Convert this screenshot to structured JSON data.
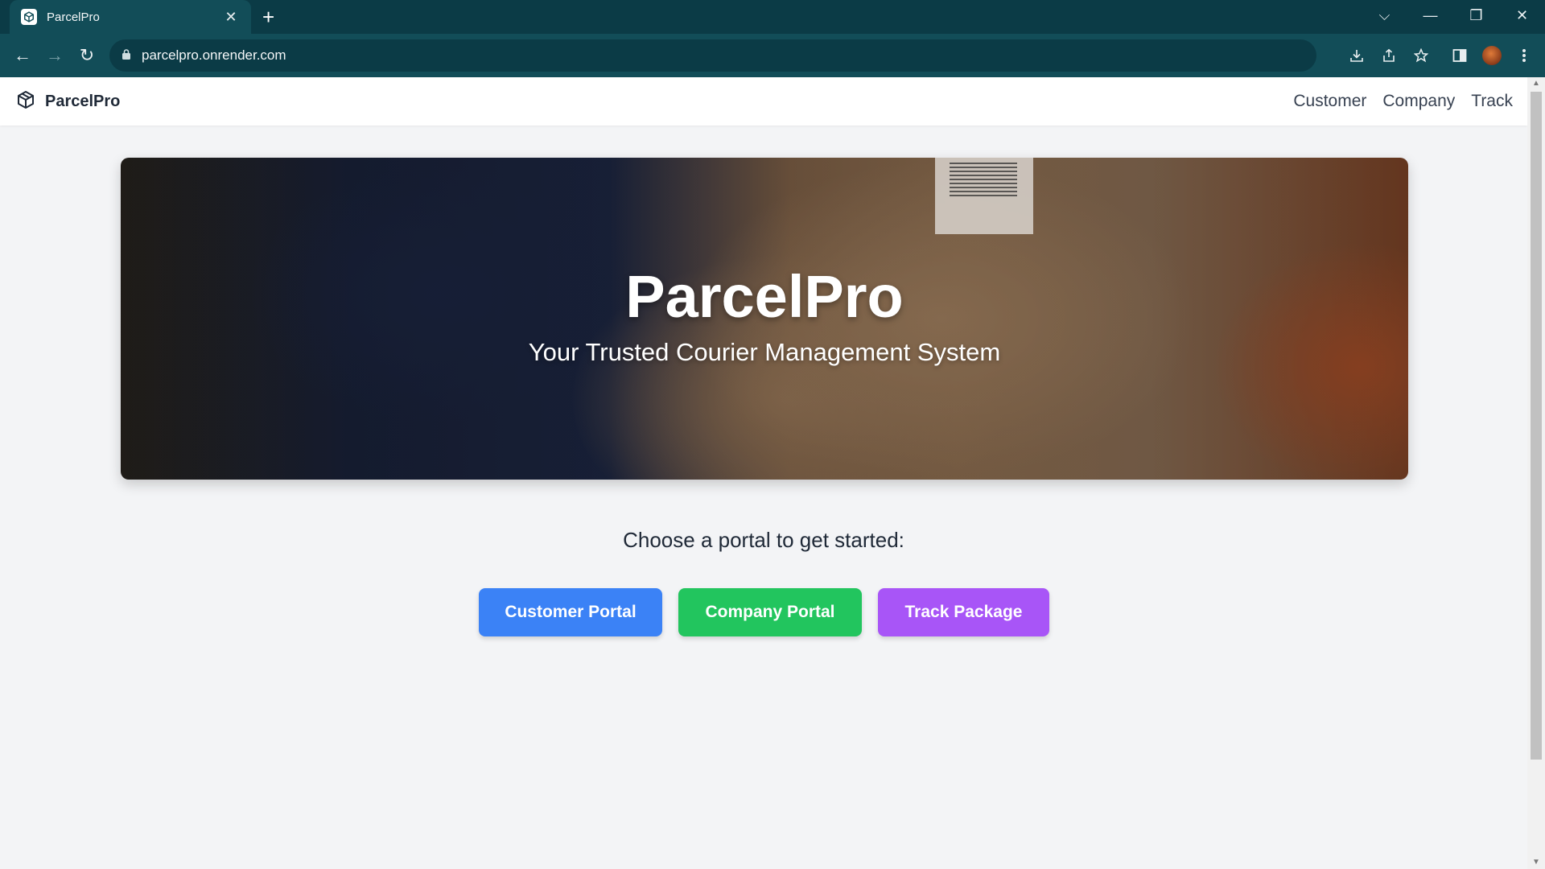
{
  "browser": {
    "tab_title": "ParcelPro",
    "tab_close": "✕",
    "new_tab": "+",
    "url": "parcelpro.onrender.com",
    "window_controls": {
      "dropdown": "⌵",
      "minimize": "—",
      "restore": "❐",
      "close": "✕"
    },
    "nav": {
      "back": "←",
      "forward": "→",
      "reload": "↻"
    },
    "toolbar_icons": [
      "download-icon",
      "share-icon",
      "bookmark-star-icon",
      "side-panel-icon",
      "profile-avatar",
      "menu-icon"
    ]
  },
  "navbar": {
    "brand": "ParcelPro",
    "links": [
      "Customer",
      "Company",
      "Track"
    ]
  },
  "hero": {
    "title": "ParcelPro",
    "subtitle": "Your Trusted Courier Management System"
  },
  "main": {
    "prompt": "Choose a portal to get started:",
    "buttons": [
      {
        "label": "Customer Portal",
        "color": "#3b82f6"
      },
      {
        "label": "Company Portal",
        "color": "#22c55e"
      },
      {
        "label": "Track Package",
        "color": "#a855f7"
      }
    ]
  },
  "colors": {
    "chrome_bg": "#0b3b46",
    "toolbar_bg": "#124d58",
    "page_bg": "#f3f4f6"
  }
}
